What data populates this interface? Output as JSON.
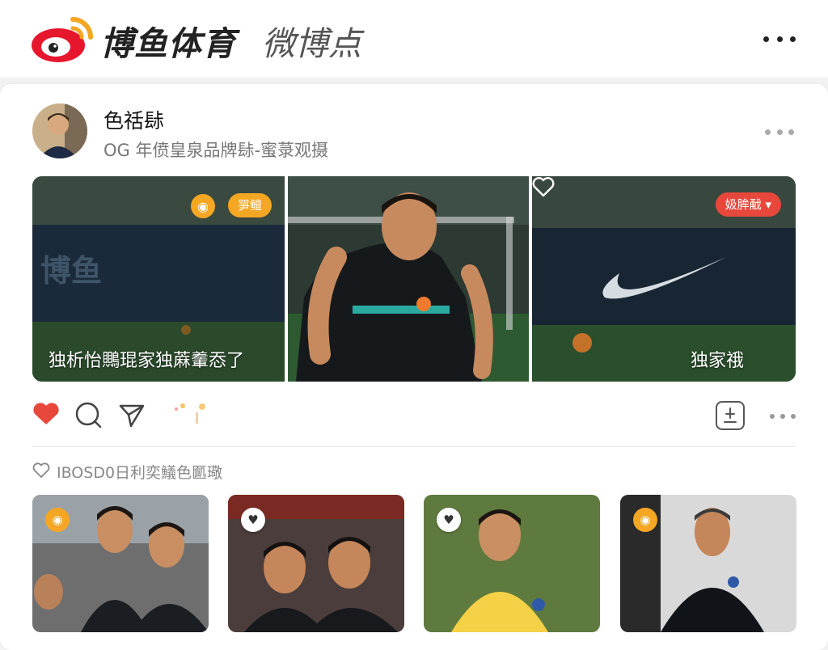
{
  "header": {
    "brand_name": "博鱼体育",
    "brand_sub": "微博点",
    "logo_icon": "weibo-logo",
    "more_icon": "more-horizontal-icon"
  },
  "post": {
    "author": "色䄆䦊",
    "meta": "OG 年偾皇泉品牌䦊-蜜菉观摄",
    "more_icon": "more-horizontal-icon",
    "media": {
      "badge_pill_label": "㖐鳣",
      "overlay_left_text": "独析怡䴍琨家独蔴䡨㤁了",
      "tag_label": "㚫䏬㦷",
      "overlay_right_text": "独家䄉"
    },
    "actions": {
      "like_icon": "heart-filled-icon",
      "comment_icon": "comment-icon",
      "share_icon": "share-icon",
      "save_icon": "bookmark-icon",
      "more_icon": "more-horizontal-icon"
    },
    "likes_text": "IBOSD0日利奕䲑色㔳璥"
  },
  "thumbnails": [
    {
      "badge": "weibo-icon",
      "badge_style": "yellow",
      "label": "thumb-two-players"
    },
    {
      "badge": "heart-icon",
      "badge_style": "white",
      "label": "thumb-two-players-talking"
    },
    {
      "badge": "heart-icon",
      "badge_style": "white",
      "label": "thumb-player-yellow-shirt"
    },
    {
      "badge": "weibo-icon",
      "badge_style": "yellow",
      "label": "thumb-coach"
    }
  ],
  "colors": {
    "accent_red": "#e8473b",
    "accent_orange": "#f5a623",
    "text_primary": "#222222",
    "text_secondary": "#777777"
  }
}
